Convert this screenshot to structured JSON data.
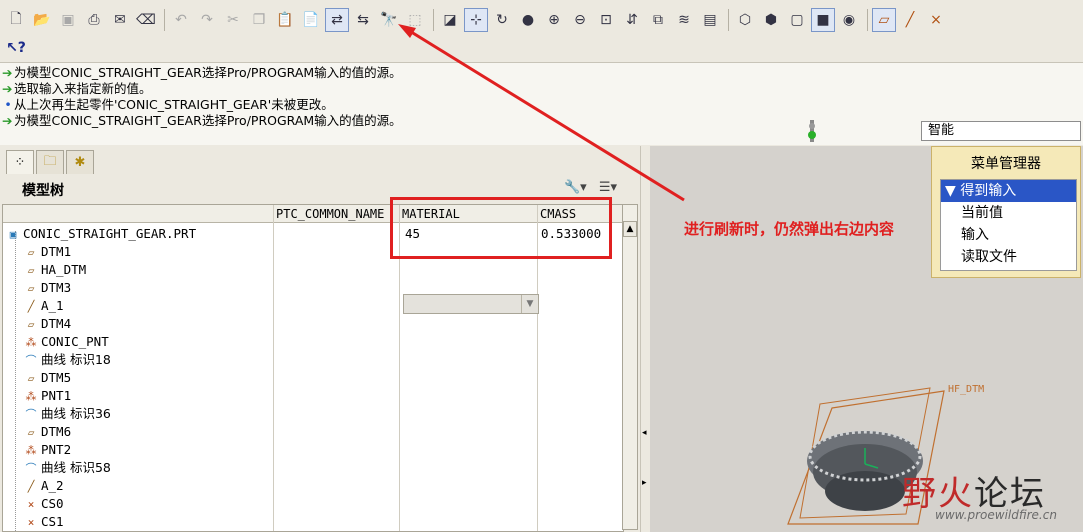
{
  "toolbar": {
    "row1_icons": [
      "new-icon",
      "open-icon",
      "save-icon",
      "print-icon",
      "send-icon",
      "erase-icon",
      "undo-icon",
      "redo-icon",
      "cut-icon",
      "copy-icon",
      "paste-icon",
      "paste-special-icon",
      "regenerate-icon",
      "regenerate-manager-icon",
      "find-icon",
      "select-box-icon",
      "view-orient-icon",
      "spin-center-icon",
      "spin-icon",
      "shade-icon",
      "zoom-in-icon",
      "zoom-out-icon",
      "refit-icon",
      "repaint-icon",
      "saved-views-icon",
      "layers-icon",
      "view-manager-icon",
      "wireframe-icon",
      "hidden-line-icon",
      "no-hidden-icon",
      "shading-icon",
      "enhanced-realism-icon",
      "datum-planes-icon",
      "datum-axes-icon",
      "datum-points-icon"
    ],
    "row2_icons": [
      "context-help-icon"
    ]
  },
  "messages": [
    {
      "type": "arrow",
      "text": "为模型CONIC_STRAIGHT_GEAR选择Pro/PROGRAM输入的值的源。"
    },
    {
      "type": "arrow",
      "text": "选取输入来指定新的值。"
    },
    {
      "type": "dot",
      "text": "从上次再生起零件'CONIC_STRAIGHT_GEAR'未被更改。"
    },
    {
      "type": "arrow",
      "text": "为模型CONIC_STRAIGHT_GEAR选择Pro/PROGRAM输入的值的源。"
    }
  ],
  "filter": {
    "value": "智能"
  },
  "model_tree": {
    "title": "模型树",
    "columns": [
      "PTC_COMMON_NAME",
      "MATERIAL",
      "CMASS"
    ],
    "root": {
      "name": "CONIC_STRAIGHT_GEAR.PRT",
      "material": "45",
      "cmass": "0.533000"
    },
    "items": [
      {
        "icon": "datum",
        "label": "DTM1"
      },
      {
        "icon": "datum",
        "label": "HA_DTM"
      },
      {
        "icon": "datum",
        "label": "DTM3"
      },
      {
        "icon": "axis",
        "label": "A_1"
      },
      {
        "icon": "datum",
        "label": "DTM4"
      },
      {
        "icon": "pnt",
        "label": "CONIC_PNT"
      },
      {
        "icon": "curve",
        "label": "曲线 标识18"
      },
      {
        "icon": "datum",
        "label": "DTM5"
      },
      {
        "icon": "pnt",
        "label": "PNT1"
      },
      {
        "icon": "curve",
        "label": "曲线 标识36"
      },
      {
        "icon": "datum",
        "label": "DTM6"
      },
      {
        "icon": "pnt",
        "label": "PNT2"
      },
      {
        "icon": "curve",
        "label": "曲线 标识58"
      },
      {
        "icon": "axis",
        "label": "A_2"
      },
      {
        "icon": "csys",
        "label": "CS0"
      },
      {
        "icon": "csys",
        "label": "CS1"
      }
    ]
  },
  "annotation": {
    "text": "进行刷新时，仍然弹出右边内容",
    "color": "#e02020"
  },
  "menu_manager": {
    "title": "菜单管理器",
    "header": "得到输入",
    "items": [
      "当前值",
      "输入",
      "读取文件"
    ]
  },
  "graphics": {
    "datum_label": "HF_DTM"
  },
  "watermark": {
    "part1": "野",
    "part2": "火",
    "part3": "论坛",
    "url": "www.proewildfire.cn"
  }
}
